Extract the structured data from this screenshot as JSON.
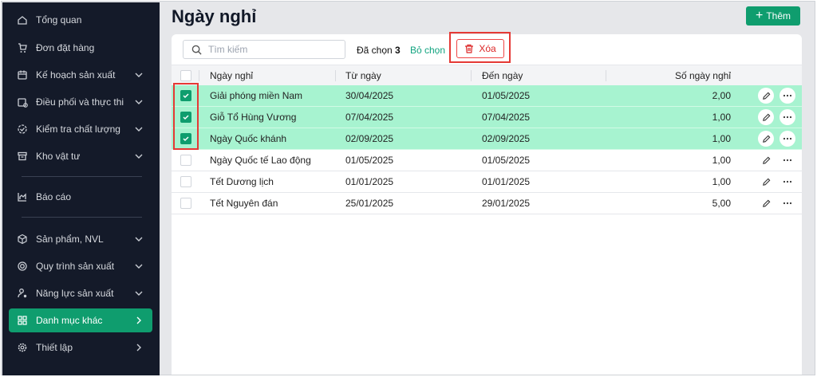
{
  "sidebar": {
    "items": [
      {
        "label": "Tổng quan",
        "icon": "home-icon",
        "chevron": ""
      },
      {
        "label": "Đơn đặt hàng",
        "icon": "cart-icon",
        "chevron": ""
      },
      {
        "label": "Kế hoạch sản xuất",
        "icon": "calendar-icon",
        "chevron": "down"
      },
      {
        "label": "Điều phối và thực thi",
        "icon": "calendar-clock-icon",
        "chevron": "down"
      },
      {
        "label": "Kiểm tra chất lượng",
        "icon": "check-circle-icon",
        "chevron": "down"
      },
      {
        "label": "Kho vật tư",
        "icon": "archive-icon",
        "chevron": "down"
      },
      {
        "label": "Báo cáo",
        "icon": "chart-icon",
        "chevron": ""
      },
      {
        "label": "Sản phẩm, NVL",
        "icon": "box-icon",
        "chevron": "down"
      },
      {
        "label": "Quy trình sản xuất",
        "icon": "process-icon",
        "chevron": "down"
      },
      {
        "label": "Năng lực sản xuất",
        "icon": "user-gear-icon",
        "chevron": "down"
      },
      {
        "label": "Danh mục khác",
        "icon": "grid-icon",
        "chevron": "right",
        "active": true
      },
      {
        "label": "Thiết lập",
        "icon": "gear-icon",
        "chevron": "right"
      }
    ]
  },
  "page": {
    "title": "Ngày nghỉ",
    "add_label": "Thêm"
  },
  "toolbar": {
    "search_placeholder": "Tìm kiếm",
    "selected_prefix": "Đã chọn",
    "selected_count": "3",
    "unselect_label": "Bỏ chọn",
    "delete_label": "Xóa"
  },
  "table": {
    "headers": [
      "Ngày nghỉ",
      "Từ ngày",
      "Đến ngày",
      "Số ngày nghỉ"
    ],
    "rows": [
      {
        "name": "Giải phóng miền Nam",
        "from": "30/04/2025",
        "to": "01/05/2025",
        "days": "2,00",
        "checked": true
      },
      {
        "name": "Giỗ Tổ Hùng Vương",
        "from": "07/04/2025",
        "to": "07/04/2025",
        "days": "1,00",
        "checked": true
      },
      {
        "name": "Ngày Quốc khánh",
        "from": "02/09/2025",
        "to": "02/09/2025",
        "days": "1,00",
        "checked": true
      },
      {
        "name": "Ngày Quốc tế Lao động",
        "from": "01/05/2025",
        "to": "01/05/2025",
        "days": "1,00",
        "checked": false
      },
      {
        "name": "Tết Dương lịch",
        "from": "01/01/2025",
        "to": "01/01/2025",
        "days": "1,00",
        "checked": false
      },
      {
        "name": "Tết Nguyên đán",
        "from": "25/01/2025",
        "to": "29/01/2025",
        "days": "5,00",
        "checked": false
      }
    ]
  },
  "colors": {
    "accent": "#0f9d6e",
    "sidebar": "#141a29",
    "selected_row": "#a7f3d0",
    "danger": "#dc2626"
  }
}
